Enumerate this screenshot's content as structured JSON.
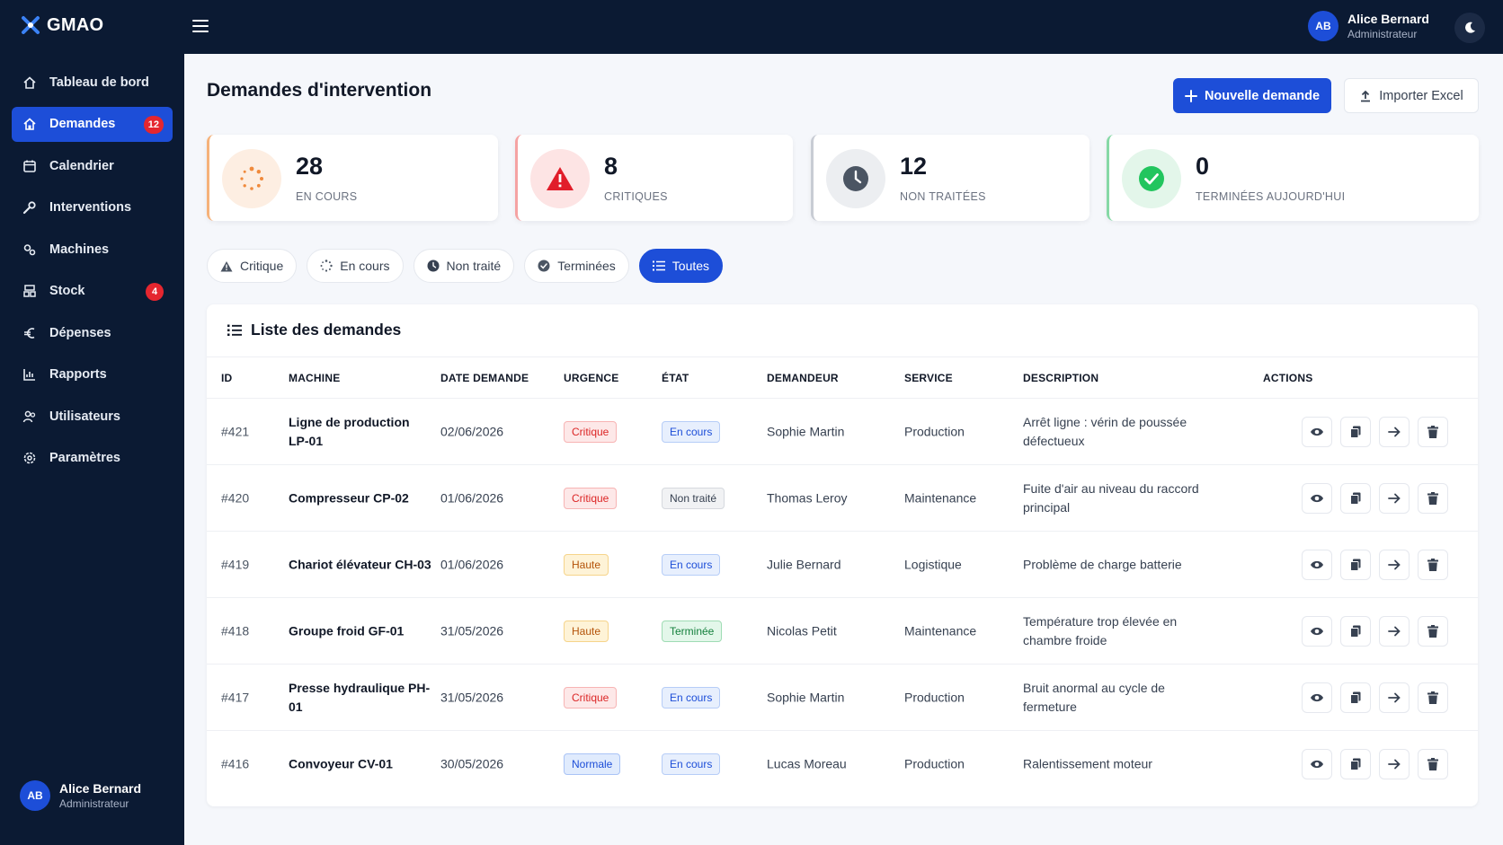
{
  "app": {
    "logo_text": "GMAO"
  },
  "user": {
    "initials": "AB",
    "name": "Alice Bernard",
    "role": "Administrateur"
  },
  "sidebar": {
    "items": [
      {
        "label": "Tableau de bord",
        "icon": "home-icon"
      },
      {
        "label": "Demandes",
        "icon": "home-icon",
        "badge": "12",
        "active": true
      },
      {
        "label": "Calendrier",
        "icon": "calendar-icon"
      },
      {
        "label": "Interventions",
        "icon": "wrench-icon"
      },
      {
        "label": "Machines",
        "icon": "cogs-icon"
      },
      {
        "label": "Stock",
        "icon": "warehouse-icon",
        "badge": "4"
      },
      {
        "label": "Dépenses",
        "icon": "euro-icon"
      },
      {
        "label": "Rapports",
        "icon": "chart-icon"
      },
      {
        "label": "Utilisateurs",
        "icon": "users-icon"
      },
      {
        "label": "Paramètres",
        "icon": "settings-icon"
      }
    ]
  },
  "header": {
    "title": "Demandes d'intervention",
    "new_button": "Nouvelle demande",
    "import_button": "Importer Excel"
  },
  "stats": [
    {
      "value": "28",
      "label": "EN COURS",
      "icon": "spinner-icon"
    },
    {
      "value": "8",
      "label": "CRITIQUES",
      "icon": "warning-icon"
    },
    {
      "value": "12",
      "label": "NON TRAITÉES",
      "icon": "clock-icon"
    },
    {
      "value": "0",
      "label": "TERMINÉES AUJOURD'HUI",
      "icon": "check-icon"
    }
  ],
  "filters": [
    {
      "label": "Critique",
      "icon": "warning-icon"
    },
    {
      "label": "En cours",
      "icon": "spinner-icon"
    },
    {
      "label": "Non traité",
      "icon": "clock-icon"
    },
    {
      "label": "Terminées",
      "icon": "check-icon"
    },
    {
      "label": "Toutes",
      "icon": "list-icon",
      "active": true
    }
  ],
  "table": {
    "title": "Liste des demandes",
    "columns": [
      "ID",
      "MACHINE",
      "DATE DEMANDE",
      "URGENCE",
      "ÉTAT",
      "DEMANDEUR",
      "SERVICE",
      "DESCRIPTION",
      "ACTIONS"
    ],
    "rows": [
      {
        "id": "#421",
        "machine": "Ligne de production LP-01",
        "date": "02/06/2026",
        "urgence": "Critique",
        "etat": "En cours",
        "demandeur": "Sophie Martin",
        "service": "Production",
        "description": "Arrêt ligne : vérin de poussée défectueux"
      },
      {
        "id": "#420",
        "machine": "Compresseur CP-02",
        "date": "01/06/2026",
        "urgence": "Critique",
        "etat": "Non traité",
        "demandeur": "Thomas Leroy",
        "service": "Maintenance",
        "description": "Fuite d'air au niveau du raccord principal"
      },
      {
        "id": "#419",
        "machine": "Chariot élévateur CH-03",
        "date": "01/06/2026",
        "urgence": "Haute",
        "etat": "En cours",
        "demandeur": "Julie Bernard",
        "service": "Logistique",
        "description": "Problème de charge batterie"
      },
      {
        "id": "#418",
        "machine": "Groupe froid GF-01",
        "date": "31/05/2026",
        "urgence": "Haute",
        "etat": "Terminée",
        "demandeur": "Nicolas Petit",
        "service": "Maintenance",
        "description": "Température trop élevée en chambre froide"
      },
      {
        "id": "#417",
        "machine": "Presse hydraulique PH-01",
        "date": "31/05/2026",
        "urgence": "Critique",
        "etat": "En cours",
        "demandeur": "Sophie Martin",
        "service": "Production",
        "description": "Bruit anormal au cycle de fermeture"
      },
      {
        "id": "#416",
        "machine": "Convoyeur CV-01",
        "date": "30/05/2026",
        "urgence": "Normale",
        "etat": "En cours",
        "demandeur": "Lucas Moreau",
        "service": "Production",
        "description": "Ralentissement moteur"
      }
    ]
  },
  "colors": {
    "sidebar_bg": "#0b1a33",
    "accent": "#1d4ed8",
    "danger": "#dc2626",
    "warning": "#f59e0b",
    "success": "#22c55e"
  }
}
